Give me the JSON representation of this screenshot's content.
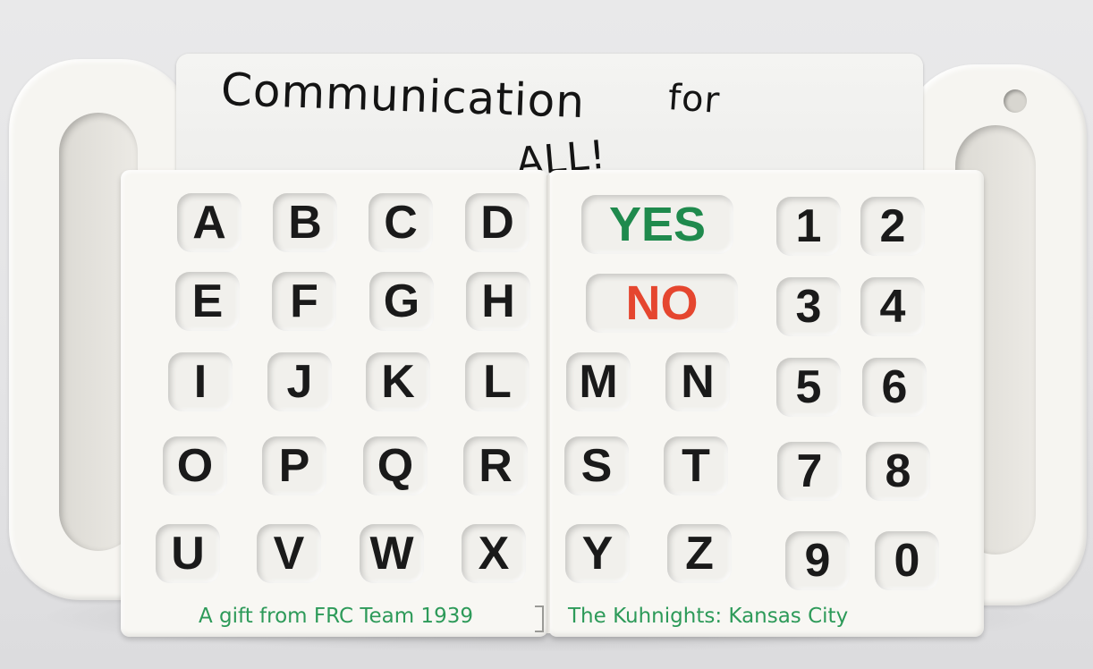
{
  "whiteboard": {
    "line1": "Communication",
    "line2": "for",
    "line3": "ALL!"
  },
  "keys": {
    "A": "A",
    "B": "B",
    "C": "C",
    "D": "D",
    "E": "E",
    "F": "F",
    "G": "G",
    "H": "H",
    "I": "I",
    "J": "J",
    "K": "K",
    "L": "L",
    "O": "O",
    "P": "P",
    "Q": "Q",
    "R": "R",
    "U": "U",
    "V": "V",
    "W": "W",
    "X": "X",
    "M": "M",
    "N": "N",
    "S": "S",
    "T": "T",
    "Y": "Y",
    "Z": "Z",
    "n1": "1",
    "n2": "2",
    "n3": "3",
    "n4": "4",
    "n5": "5",
    "n6": "6",
    "n7": "7",
    "n8": "8",
    "n9": "9",
    "n0": "0"
  },
  "answers": {
    "yes": "YES",
    "no": "NO"
  },
  "footer": {
    "left": "A gift from FRC Team 1939",
    "right": "The Kuhnights: Kansas City"
  },
  "colors": {
    "yes": "#1f8a4d",
    "no": "#e5462f",
    "footer_text": "#2d9a59",
    "letters": "#1a1a1a"
  }
}
